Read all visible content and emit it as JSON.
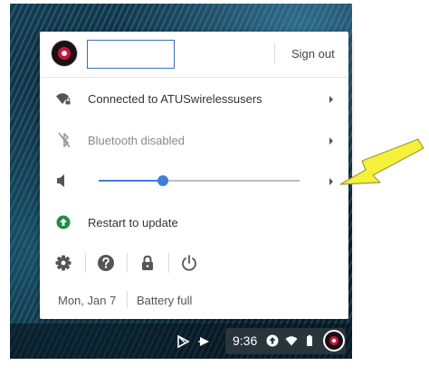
{
  "header": {
    "name_value": "",
    "sign_out_label": "Sign out"
  },
  "network": {
    "label": "Connected to ATUSwirelessusers",
    "icon": "wifi-locked-icon"
  },
  "bluetooth": {
    "label": "Bluetooth disabled",
    "icon": "bluetooth-disabled-icon"
  },
  "volume": {
    "icon": "volume-icon",
    "level": 0.32
  },
  "update": {
    "label": "Restart to update",
    "icon": "update-arrow-icon",
    "color": "#1e8e3e"
  },
  "system_buttons": [
    {
      "icon": "gear-icon"
    },
    {
      "icon": "help-icon"
    },
    {
      "icon": "lock-icon"
    },
    {
      "icon": "power-icon"
    }
  ],
  "footer": {
    "date": "Mon, Jan 7",
    "battery": "Battery full"
  },
  "shelf": {
    "time": "9:36"
  },
  "colors": {
    "accent": "#3f7fd8",
    "annotation_arrow": "#f5f03a"
  }
}
